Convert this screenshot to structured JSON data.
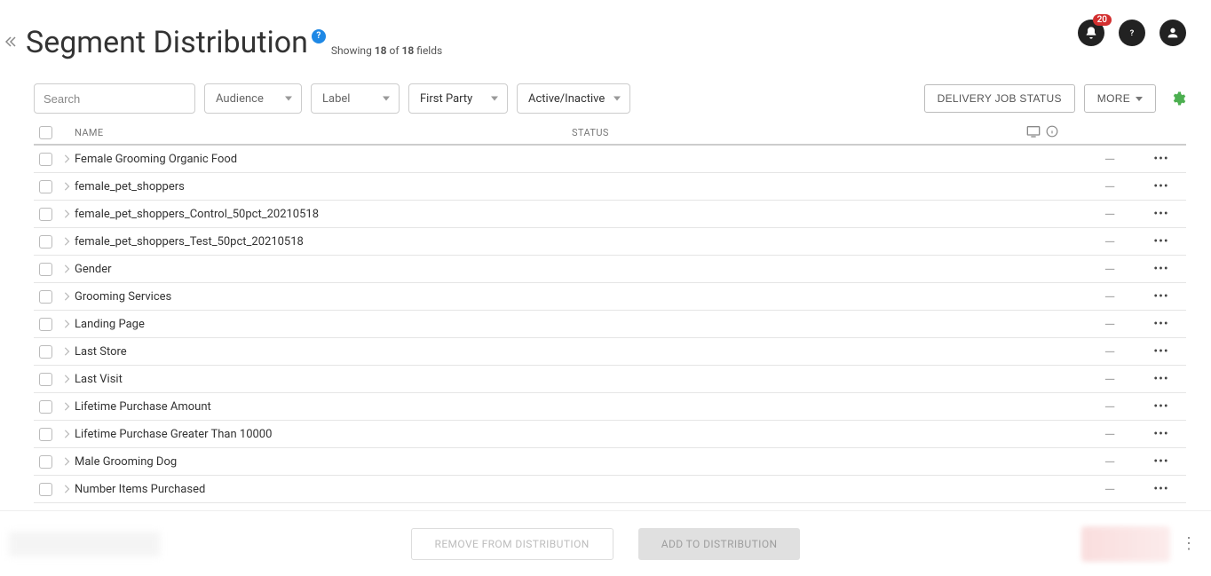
{
  "header": {
    "title": "Segment Distribution",
    "help_glyph": "?",
    "showing_prefix": "Showing ",
    "showing_shown": "18",
    "showing_of": " of ",
    "showing_total": "18",
    "showing_suffix": " fields",
    "notification_count": "20"
  },
  "filters": {
    "search_placeholder": "Search",
    "audience": "Audience",
    "label": "Label",
    "party": "First Party",
    "active": "Active/Inactive"
  },
  "toolbar": {
    "delivery": "DELIVERY JOB STATUS",
    "more": "MORE"
  },
  "table": {
    "columns": {
      "name": "NAME",
      "status": "STATUS"
    },
    "rows": [
      {
        "name": "Female Grooming Organic Food",
        "status": "—"
      },
      {
        "name": "female_pet_shoppers",
        "status": "—"
      },
      {
        "name": "female_pet_shoppers_Control_50pct_20210518",
        "status": "—"
      },
      {
        "name": "female_pet_shoppers_Test_50pct_20210518",
        "status": "—"
      },
      {
        "name": "Gender",
        "status": "—"
      },
      {
        "name": "Grooming Services",
        "status": "—"
      },
      {
        "name": "Landing Page",
        "status": "—"
      },
      {
        "name": "Last Store",
        "status": "—"
      },
      {
        "name": "Last Visit",
        "status": "—"
      },
      {
        "name": "Lifetime Purchase Amount",
        "status": "—"
      },
      {
        "name": "Lifetime Purchase Greater Than 10000",
        "status": "—"
      },
      {
        "name": "Male Grooming Dog",
        "status": "—"
      },
      {
        "name": "Number Items Purchased",
        "status": "—"
      }
    ]
  },
  "footer": {
    "remove": "REMOVE FROM DISTRIBUTION",
    "add": "ADD TO DISTRIBUTION"
  }
}
